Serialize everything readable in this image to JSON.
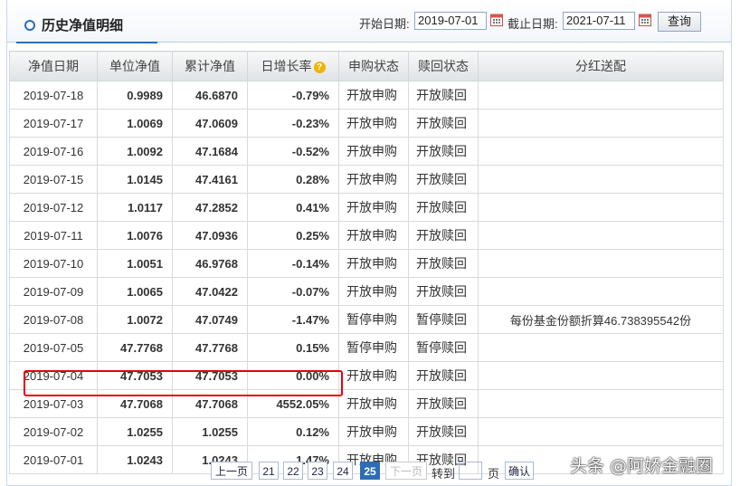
{
  "header": {
    "title": "历史净值明细",
    "start_label": "开始日期:",
    "start_value": "2019-07-01",
    "end_label": "截止日期:",
    "end_value": "2021-07-11",
    "query_label": "查询"
  },
  "columns": [
    "净值日期",
    "单位净值",
    "累计净值",
    "日增长率",
    "申购状态",
    "赎回状态",
    "分红送配"
  ],
  "rows": [
    {
      "date": "2019-07-18",
      "unit": "0.9989",
      "acc": "46.6870",
      "rate": "-0.79%",
      "dir": "down",
      "sub": "开放申购",
      "red": "开放赎回",
      "div": ""
    },
    {
      "date": "2019-07-17",
      "unit": "1.0069",
      "acc": "47.0609",
      "rate": "-0.23%",
      "dir": "down",
      "sub": "开放申购",
      "red": "开放赎回",
      "div": ""
    },
    {
      "date": "2019-07-16",
      "unit": "1.0092",
      "acc": "47.1684",
      "rate": "-0.52%",
      "dir": "down",
      "sub": "开放申购",
      "red": "开放赎回",
      "div": ""
    },
    {
      "date": "2019-07-15",
      "unit": "1.0145",
      "acc": "47.4161",
      "rate": "0.28%",
      "dir": "up",
      "sub": "开放申购",
      "red": "开放赎回",
      "div": ""
    },
    {
      "date": "2019-07-12",
      "unit": "1.0117",
      "acc": "47.2852",
      "rate": "0.41%",
      "dir": "up",
      "sub": "开放申购",
      "red": "开放赎回",
      "div": ""
    },
    {
      "date": "2019-07-11",
      "unit": "1.0076",
      "acc": "47.0936",
      "rate": "0.25%",
      "dir": "up",
      "sub": "开放申购",
      "red": "开放赎回",
      "div": ""
    },
    {
      "date": "2019-07-10",
      "unit": "1.0051",
      "acc": "46.9768",
      "rate": "-0.14%",
      "dir": "down",
      "sub": "开放申购",
      "red": "开放赎回",
      "div": ""
    },
    {
      "date": "2019-07-09",
      "unit": "1.0065",
      "acc": "47.0422",
      "rate": "-0.07%",
      "dir": "down",
      "sub": "开放申购",
      "red": "开放赎回",
      "div": ""
    },
    {
      "date": "2019-07-08",
      "unit": "1.0072",
      "acc": "47.0749",
      "rate": "-1.47%",
      "dir": "down",
      "sub": "暂停申购",
      "red": "暂停赎回",
      "div": "每份基金份额折算46.738395542份"
    },
    {
      "date": "2019-07-05",
      "unit": "47.7768",
      "acc": "47.7768",
      "rate": "0.15%",
      "dir": "up",
      "sub": "暂停申购",
      "red": "暂停赎回",
      "div": ""
    },
    {
      "date": "2019-07-04",
      "unit": "47.7053",
      "acc": "47.7053",
      "rate": "0.00%",
      "dir": "flat",
      "sub": "开放申购",
      "red": "开放赎回",
      "div": ""
    },
    {
      "date": "2019-07-03",
      "unit": "47.7068",
      "acc": "47.7068",
      "rate": "4552.05%",
      "dir": "up",
      "sub": "开放申购",
      "red": "开放赎回",
      "div": ""
    },
    {
      "date": "2019-07-02",
      "unit": "1.0255",
      "acc": "1.0255",
      "rate": "0.12%",
      "dir": "up",
      "sub": "开放申购",
      "red": "开放赎回",
      "div": ""
    },
    {
      "date": "2019-07-01",
      "unit": "1.0243",
      "acc": "1.0243",
      "rate": "1.47%",
      "dir": "up",
      "sub": "开放申购",
      "red": "开放赎回",
      "div": ""
    }
  ],
  "pager": {
    "prev": "上一页",
    "pages": [
      "21",
      "22",
      "23",
      "24",
      "25"
    ],
    "current": "25",
    "next": "下一页",
    "goto_label": "转到",
    "page_unit": "页",
    "confirm": "确认"
  },
  "watermark": "头条 @阿娇金融圈",
  "colors": {
    "up": "#d00000",
    "down": "#1a8a1a",
    "accent": "#2d6db5",
    "highlight": "#e8000a"
  }
}
